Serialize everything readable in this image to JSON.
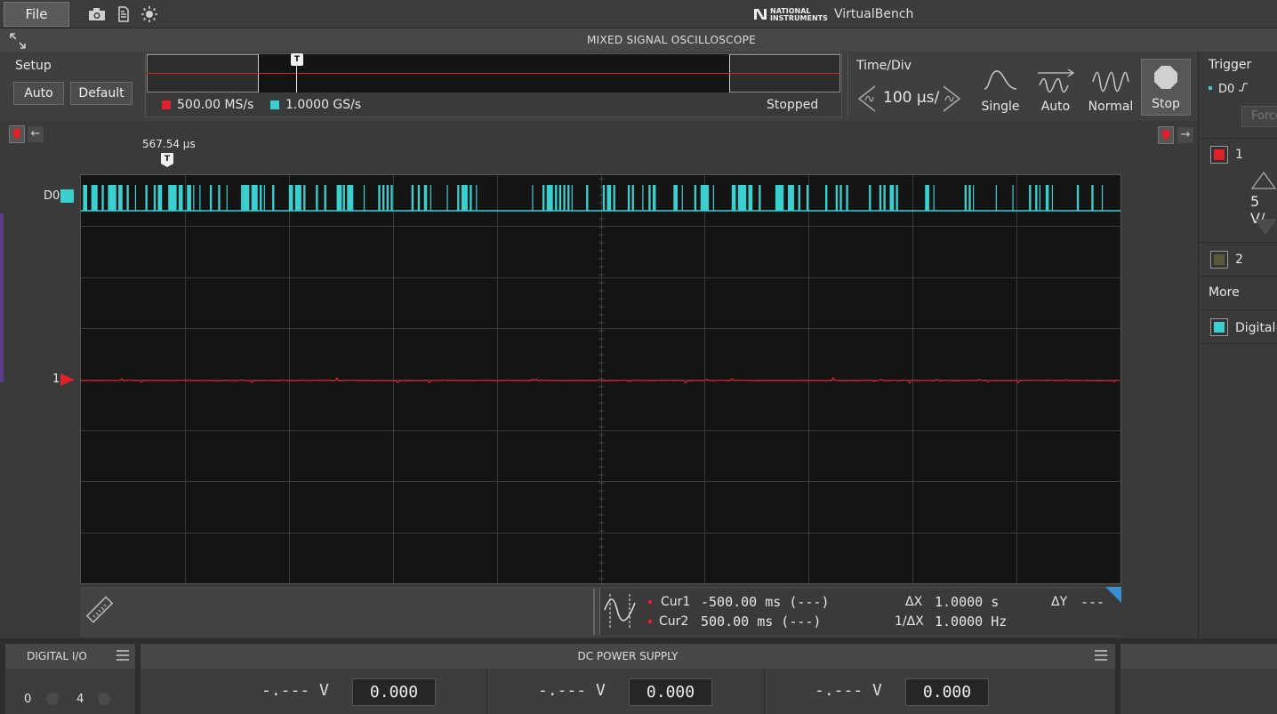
{
  "topbar": {
    "file_label": "File",
    "icons": [
      "camera-icon",
      "file-export-icon",
      "brightness-icon"
    ],
    "brand_lines": [
      "NATIONAL",
      "INSTRUMENTS"
    ],
    "app_name": "VirtualBench"
  },
  "window": {
    "title": "MIXED SIGNAL OSCILLOSCOPE"
  },
  "setup": {
    "label": "Setup",
    "auto_label": "Auto",
    "default_label": "Default"
  },
  "acquisition": {
    "rate_analog": "500.00 MS/s",
    "rate_digital": "1.0000 GS/s",
    "status": "Stopped",
    "trigger_marker": "T"
  },
  "timebase": {
    "label": "Time/Div",
    "value": "100 µs/"
  },
  "trigger_modes": [
    {
      "label": "Single",
      "icon": "single-wave-icon"
    },
    {
      "label": "Auto",
      "icon": "auto-wave-icon"
    },
    {
      "label": "Normal",
      "icon": "normal-wave-icon"
    },
    {
      "label": "Stop",
      "icon": "stop-icon",
      "active": true
    }
  ],
  "trigger_panel": {
    "label": "Trigger",
    "source": "D0",
    "force_label": "Force"
  },
  "channels": {
    "ch1_label": "1",
    "ch1_scale": "5 V/",
    "ch2_label": "2",
    "more_label": "More",
    "digital_label": "Digital"
  },
  "scope": {
    "trigger_time": "567.54 µs",
    "d0_label": "D0",
    "ch1_marker_label": "1"
  },
  "cursors": {
    "cur1_label": "Cur1",
    "cur1_value": "-500.00 ms (---)",
    "cur2_label": "Cur2",
    "cur2_value": "500.00 ms (---)",
    "dx_label": "ΔX",
    "dx_value": "1.0000 s",
    "inv_dx_label": "1/ΔX",
    "inv_dx_value": "1.0000 Hz",
    "dy_label": "ΔY",
    "dy_value": "---"
  },
  "digital_io": {
    "title": "DIGITAL I/O",
    "line0": "0",
    "line4": "4"
  },
  "dc_supply": {
    "title": "DC POWER SUPPLY",
    "outputs": [
      {
        "measured": "-.--- V",
        "setpoint": "0.000"
      },
      {
        "measured": "-.--- V",
        "setpoint": "0.000"
      },
      {
        "measured": "-.--- V",
        "setpoint": "0.000"
      }
    ]
  },
  "colors": {
    "analog_ch1": "#e0202a",
    "digital_d0": "#3ccfcf",
    "plot_bg": "#141414",
    "grid": "#3a3a3a"
  },
  "plot_data": {
    "h_divisions": 10,
    "v_divisions": 8,
    "ch1_level_v": 0,
    "d0_high_segments": [
      [
        0.002,
        0.006
      ],
      [
        0.01,
        0.016
      ],
      [
        0.02,
        0.022
      ],
      [
        0.026,
        0.034
      ],
      [
        0.036,
        0.04
      ],
      [
        0.044,
        0.046
      ],
      [
        0.052,
        0.053
      ],
      [
        0.062,
        0.064
      ],
      [
        0.07,
        0.072
      ],
      [
        0.074,
        0.078
      ],
      [
        0.084,
        0.092
      ],
      [
        0.094,
        0.098
      ],
      [
        0.102,
        0.106
      ],
      [
        0.108,
        0.109
      ],
      [
        0.114,
        0.115
      ],
      [
        0.124,
        0.126
      ],
      [
        0.132,
        0.134
      ],
      [
        0.14,
        0.141
      ],
      [
        0.154,
        0.156
      ],
      [
        0.156,
        0.162
      ],
      [
        0.164,
        0.17
      ],
      [
        0.172,
        0.174
      ],
      [
        0.176,
        0.177
      ],
      [
        0.184,
        0.186
      ],
      [
        0.2,
        0.204
      ],
      [
        0.206,
        0.212
      ],
      [
        0.214,
        0.216
      ],
      [
        0.226,
        0.228
      ],
      [
        0.234,
        0.236
      ],
      [
        0.246,
        0.251
      ],
      [
        0.252,
        0.254
      ],
      [
        0.256,
        0.262
      ],
      [
        0.272,
        0.272
      ],
      [
        0.286,
        0.288
      ],
      [
        0.29,
        0.292
      ],
      [
        0.294,
        0.296
      ],
      [
        0.298,
        0.3
      ],
      [
        0.318,
        0.32
      ],
      [
        0.324,
        0.326
      ],
      [
        0.33,
        0.333
      ],
      [
        0.336,
        0.337
      ],
      [
        0.352,
        0.353
      ],
      [
        0.362,
        0.364
      ],
      [
        0.366,
        0.372
      ],
      [
        0.374,
        0.376
      ],
      [
        0.38,
        0.381
      ],
      [
        0.434,
        0.435
      ],
      [
        0.444,
        0.446
      ],
      [
        0.448,
        0.454
      ],
      [
        0.456,
        0.458
      ],
      [
        0.46,
        0.462
      ],
      [
        0.464,
        0.466
      ],
      [
        0.468,
        0.47
      ],
      [
        0.472,
        0.473
      ],
      [
        0.486,
        0.488
      ],
      [
        0.502,
        0.504
      ],
      [
        0.506,
        0.51
      ],
      [
        0.512,
        0.514
      ],
      [
        0.526,
        0.528
      ],
      [
        0.53,
        0.532
      ],
      [
        0.54,
        0.541
      ],
      [
        0.546,
        0.548
      ],
      [
        0.55,
        0.553
      ],
      [
        0.57,
        0.574
      ],
      [
        0.578,
        0.579
      ],
      [
        0.59,
        0.592
      ],
      [
        0.596,
        0.604
      ],
      [
        0.608,
        0.609
      ],
      [
        0.626,
        0.63
      ],
      [
        0.632,
        0.64
      ],
      [
        0.642,
        0.646
      ],
      [
        0.652,
        0.654
      ],
      [
        0.668,
        0.676
      ],
      [
        0.68,
        0.686
      ],
      [
        0.69,
        0.692
      ],
      [
        0.698,
        0.7
      ],
      [
        0.716,
        0.718
      ],
      [
        0.726,
        0.728
      ],
      [
        0.73,
        0.732
      ],
      [
        0.736,
        0.738
      ],
      [
        0.758,
        0.76
      ],
      [
        0.768,
        0.77
      ],
      [
        0.772,
        0.774
      ],
      [
        0.778,
        0.782
      ],
      [
        0.784,
        0.786
      ],
      [
        0.812,
        0.816
      ],
      [
        0.82,
        0.821
      ],
      [
        0.85,
        0.852
      ],
      [
        0.854,
        0.856
      ],
      [
        0.858,
        0.859
      ],
      [
        0.88,
        0.881
      ],
      [
        0.896,
        0.897
      ],
      [
        0.912,
        0.914
      ],
      [
        0.918,
        0.92
      ],
      [
        0.922,
        0.923
      ],
      [
        0.928,
        0.931
      ],
      [
        0.934,
        0.935
      ],
      [
        0.958,
        0.96
      ],
      [
        0.972,
        0.974
      ],
      [
        0.982,
        0.983
      ]
    ]
  }
}
